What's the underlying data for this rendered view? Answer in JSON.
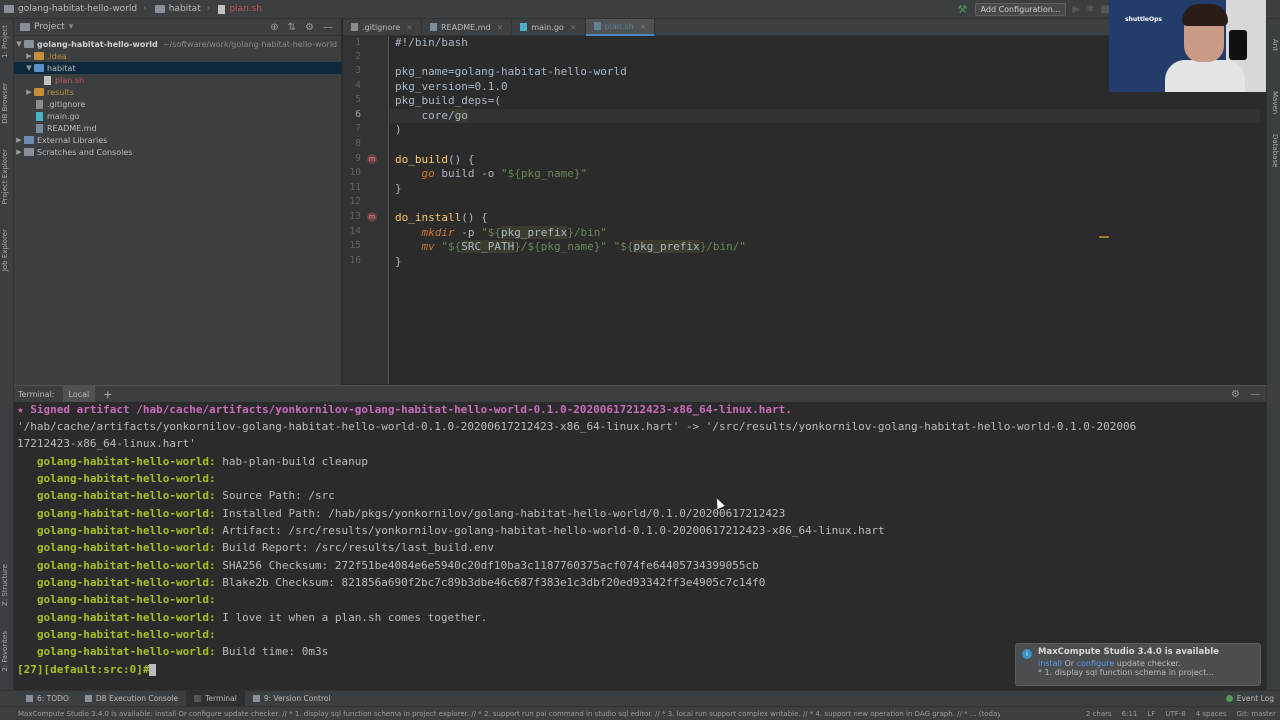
{
  "breadcrumb": {
    "project": "golang-habitat-hello-world",
    "folder": "habitat",
    "file": "plan.sh"
  },
  "toolbar_top": {
    "add_configuration": "Add Configuration..."
  },
  "project_panel": {
    "title": "Project",
    "tree": {
      "root": "golang-habitat-hello-world",
      "root_path": "~/software/work/golang-habitat-hello-world",
      "idea": ".idea",
      "habitat": "habitat",
      "plan_sh": "plan.sh",
      "results": "results",
      "gitignore": ".gitignore",
      "main_go": "main.go",
      "readme": "README.md",
      "external_libraries": "External Libraries",
      "scratches": "Scratches and Consoles"
    }
  },
  "editor_tabs": [
    {
      "label": ".gitignore"
    },
    {
      "label": "README.md"
    },
    {
      "label": "main.go"
    },
    {
      "label": "plan.sh"
    }
  ],
  "code": {
    "line_numbers": [
      "1",
      "2",
      "3",
      "4",
      "5",
      "6",
      "7",
      "8",
      "9",
      "10",
      "11",
      "12",
      "13",
      "14",
      "15",
      "16"
    ],
    "l1": "#!/bin/bash",
    "l3_var": "pkg_name",
    "l3_val": "=golang-habitat-hello-world",
    "l4_var": "pkg_version",
    "l4_val": "=0.1.0",
    "l5_var": "pkg_build_deps",
    "l5_val": "=(",
    "l6_a": "    core/",
    "l6_b": "go",
    "l7": ")",
    "l9_fn": "do_build",
    "l9_rest": "() {",
    "l10_cmd": "go",
    "l10_rest": " build -o ",
    "l10_str": "\"${pkg_name}\"",
    "l11": "}",
    "l13_fn": "do_install",
    "l13_rest": "() {",
    "l14_cmd": "mkdir",
    "l14_rest": " -p ",
    "l14_s1": "\"${",
    "l14_var": "pkg_prefix",
    "l14_s2": "}/bin\"",
    "l15_cmd": "mv",
    "l15_s1": " \"${",
    "l15_v1": "SRC_PATH",
    "l15_s2": "}/${pkg_name}\"",
    "l15_s3": " \"${",
    "l15_v2": "pkg_prefix",
    "l15_s4": "}/bin/\"",
    "l16": "}"
  },
  "video_overlay": {
    "logo_text": "shuttleOps"
  },
  "terminal": {
    "label": "Terminal:",
    "tab": "Local",
    "lines": [
      {
        "star": "★ ",
        "bold": "Signed artifact /hab/cache/artifacts/yonkornilov-golang-habitat-hello-world-0.1.0-20200617212423-x86_64-linux.hart."
      },
      {
        "plain": "'/hab/cache/artifacts/yonkornilov-golang-habitat-hello-world-0.1.0-20200617212423-x86_64-linux.hart' -> '/src/results/yonkornilov-golang-habitat-hello-world-0.1.0-202006"
      },
      {
        "plain": "17212423-x86_64-linux.hart'"
      },
      {
        "pkg": "   golang-habitat-hello-world:",
        "text": " hab-plan-build cleanup"
      },
      {
        "pkg": "   golang-habitat-hello-world:",
        "text": ""
      },
      {
        "pkg": "   golang-habitat-hello-world:",
        "text": " Source Path: /src"
      },
      {
        "pkg": "   golang-habitat-hello-world:",
        "text": " Installed Path: /hab/pkgs/yonkornilov/golang-habitat-hello-world/0.1.0/20200617212423"
      },
      {
        "pkg": "   golang-habitat-hello-world:",
        "text": " Artifact: /src/results/yonkornilov-golang-habitat-hello-world-0.1.0-20200617212423-x86_64-linux.hart"
      },
      {
        "pkg": "   golang-habitat-hello-world:",
        "text": " Build Report: /src/results/last_build.env"
      },
      {
        "pkg": "   golang-habitat-hello-world:",
        "text": " SHA256 Checksum: 272f51be4084e6e5940c20df10ba3c1187760375acf074fe64405734399055cb"
      },
      {
        "pkg": "   golang-habitat-hello-world:",
        "text": " Blake2b Checksum: 821856a690f2bc7c89b3dbe46c687f383e1c3dbf20ed93342ff3e4905c7c14f0"
      },
      {
        "pkg": "   golang-habitat-hello-world:",
        "text": ""
      },
      {
        "pkg": "   golang-habitat-hello-world:",
        "text": " I love it when a plan.sh comes together."
      },
      {
        "pkg": "   golang-habitat-hello-world:",
        "text": ""
      },
      {
        "pkg": "   golang-habitat-hello-world:",
        "text": " Build time: 0m3s"
      },
      {
        "prompt": "[27][default:src:0]#"
      }
    ]
  },
  "notification": {
    "title": "MaxCompute Studio 3.4.0 is available",
    "install": "install",
    "or": " Or ",
    "configure": "configure",
    "tail": " update checker.",
    "item": "* 1. display sql function schema in project..."
  },
  "tool_windows": [
    {
      "label": "6: TODO"
    },
    {
      "label": "DB Execution Console"
    },
    {
      "label": "Terminal"
    },
    {
      "label": "9: Version Control"
    }
  ],
  "event_log": "Event Log",
  "left_strip": [
    "1: Project",
    "DB Browser",
    "Project Explorer",
    "Job Explorer",
    "Z: Structure",
    "2: Favorites"
  ],
  "right_strip": [
    "Ant",
    "Maven",
    "Database"
  ],
  "status": {
    "message": "MaxCompute Studio 3.4.0 is available: install Or configure update checker. // * 1. display sql function schema in project explorer. // * 2. support run pai command in studio sql editor. // * 3. local run support complex writable. // * 4. support new operation in DAG graph. // * ... (today 15:50)",
    "chars": "2 chars",
    "pos": "6:11",
    "lf": "LF",
    "enc": "UTF-8",
    "indent": "4 spaces",
    "git": "Git: master"
  },
  "colors": {
    "accent": "#4a88c7",
    "package_green": "#a8c023",
    "signed_magenta": "#c96bbd",
    "link_blue": "#589df6"
  }
}
